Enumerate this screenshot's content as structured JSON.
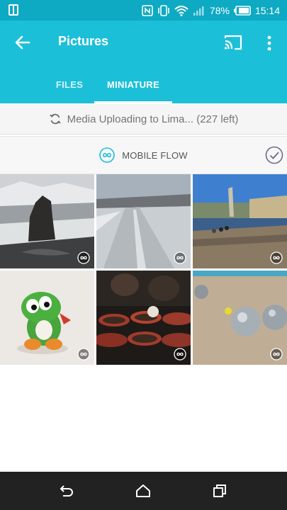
{
  "status_bar": {
    "battery": "78%",
    "time": "15:14",
    "icons": [
      "screen-icon",
      "nfc-icon",
      "vibrate-icon",
      "wifi-icon",
      "signal-icon",
      "battery-icon"
    ]
  },
  "app_bar": {
    "title": "Pictures",
    "icons": [
      "back-arrow-icon",
      "cast-icon",
      "more-vertical-icon"
    ]
  },
  "tabs": [
    {
      "label": "FILES",
      "selected": false
    },
    {
      "label": "MINIATURE",
      "selected": true
    }
  ],
  "upload_status": {
    "text": "Media Uploading to Lima... (227 left)",
    "icon": "sync-icon"
  },
  "flow_header": {
    "label": "MOBILE FLOW",
    "icons": [
      "infinity-icon",
      "check-circle-icon"
    ]
  },
  "photos": [
    {
      "subject": "black sand beach with rock",
      "badge_icon": "infinity-icon"
    },
    {
      "subject": "snowy road",
      "badge_icon": "infinity-icon"
    },
    {
      "subject": "river bank in city",
      "badge_icon": "infinity-icon"
    },
    {
      "subject": "green yoshi plush",
      "badge_icon": "infinity-icon"
    },
    {
      "subject": "beer pong cups",
      "badge_icon": "infinity-icon"
    },
    {
      "subject": "petanque balls",
      "badge_icon": "infinity-icon"
    }
  ],
  "colors": {
    "status_bar": "#0ea9c2",
    "app_bar": "#1cbfd8",
    "accent": "#1cbfd8",
    "nav_bar": "#222222"
  },
  "nav_bar": {
    "icons": [
      "back-nav-icon",
      "home-nav-icon",
      "recents-nav-icon"
    ]
  }
}
